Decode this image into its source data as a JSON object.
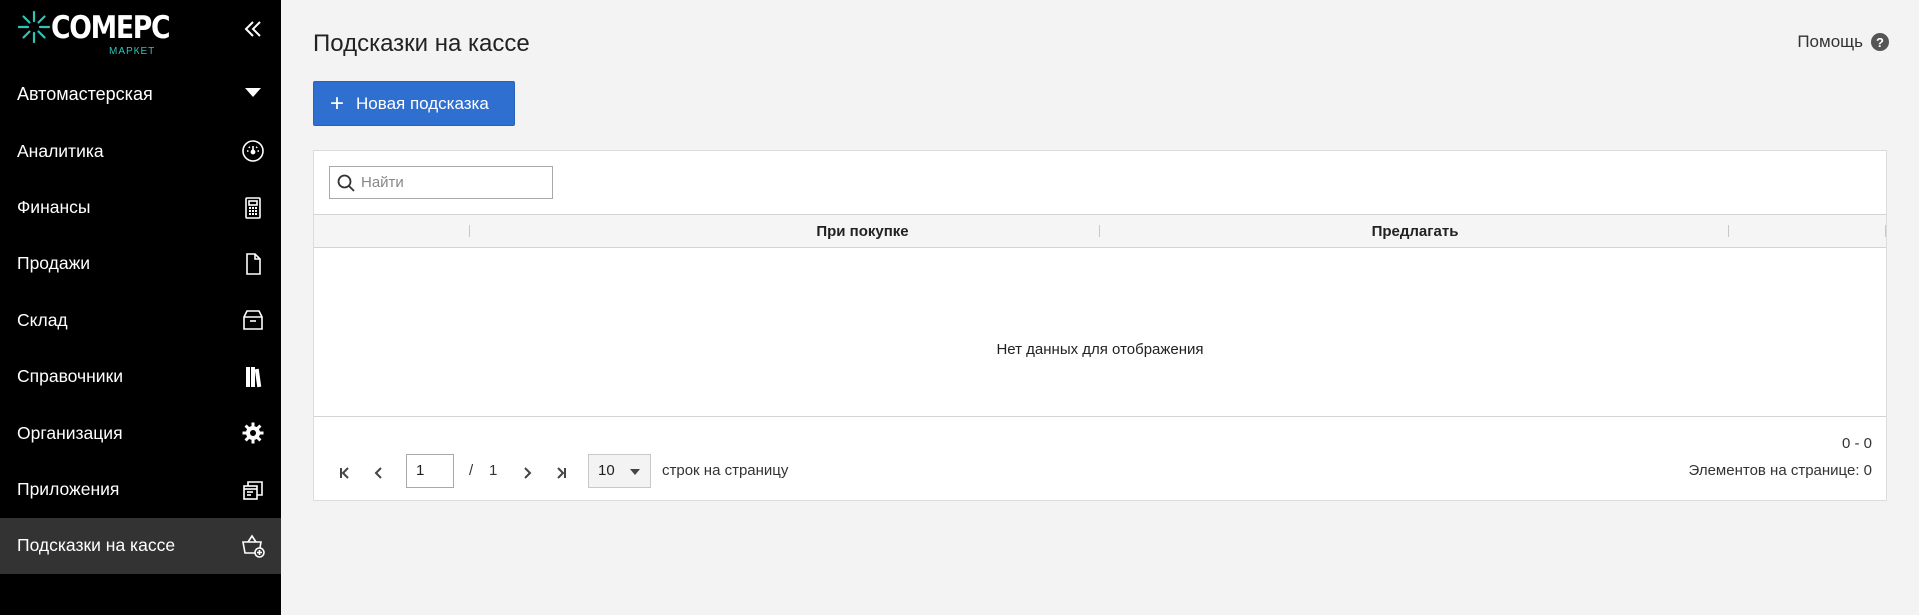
{
  "brand": {
    "name": "COMEPC",
    "subtitle": "МАРКЕТ",
    "accent_color": "#2ec4b6"
  },
  "sidebar": {
    "org_name": "Автомастерская",
    "items": [
      {
        "label": "Аналитика",
        "icon": "speedometer-icon"
      },
      {
        "label": "Финансы",
        "icon": "calculator-icon"
      },
      {
        "label": "Продажи",
        "icon": "document-icon"
      },
      {
        "label": "Склад",
        "icon": "warehouse-box-icon"
      },
      {
        "label": "Справочники",
        "icon": "books-icon"
      },
      {
        "label": "Организация",
        "icon": "gear-icon"
      },
      {
        "label": "Приложения",
        "icon": "windows-icon"
      },
      {
        "label": "Подсказки на кассе",
        "icon": "basket-plus-icon",
        "active": true
      }
    ]
  },
  "header": {
    "title": "Подсказки на кассе",
    "help_label": "Помощь"
  },
  "toolbar": {
    "new_button_label": "Новая подсказка"
  },
  "search": {
    "placeholder": "Найти"
  },
  "grid": {
    "columns": [
      "При покупке",
      "Предлагать"
    ],
    "empty_text": "Нет данных для отображения"
  },
  "pager": {
    "current_page": "1",
    "separator": "/",
    "total_pages": "1",
    "page_size": "10",
    "page_size_label": "строк на страницу",
    "range": "0 - 0",
    "items_per_page_label": "Элементов на странице: 0"
  },
  "colors": {
    "sidebar_bg": "#000000",
    "sidebar_active": "#333333",
    "primary_button": "#2f6fd0",
    "page_bg": "#f3f3f3"
  }
}
